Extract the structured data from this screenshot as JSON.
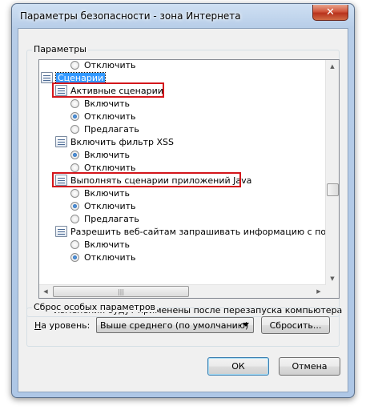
{
  "window": {
    "title": "Параметры безопасности - зона Интернета",
    "close_symbol": "✕"
  },
  "params_group": {
    "label": "Параметры"
  },
  "tree": {
    "rows": [
      {
        "type": "radio",
        "label": "Отключить",
        "checked": false
      },
      {
        "type": "category",
        "label": "Сценарии",
        "icon": "script-icon"
      },
      {
        "type": "setting",
        "label": "Активные сценарии",
        "icon": "script-icon"
      },
      {
        "type": "radio",
        "label": "Включить",
        "checked": false
      },
      {
        "type": "radio",
        "label": "Отключить",
        "checked": true
      },
      {
        "type": "radio",
        "label": "Предлагать",
        "checked": false
      },
      {
        "type": "setting",
        "label": "Включить фильтр XSS",
        "icon": "script-icon"
      },
      {
        "type": "radio",
        "label": "Включить",
        "checked": true
      },
      {
        "type": "radio",
        "label": "Отключить",
        "checked": false
      },
      {
        "type": "setting",
        "label": "Выполнять сценарии приложений Java",
        "icon": "script-icon"
      },
      {
        "type": "radio",
        "label": "Включить",
        "checked": false
      },
      {
        "type": "radio",
        "label": "Отключить",
        "checked": true
      },
      {
        "type": "radio",
        "label": "Предлагать",
        "checked": false
      },
      {
        "type": "setting",
        "label": "Разрешить веб-сайтам запрашивать информацию с помо",
        "icon": "script-icon"
      },
      {
        "type": "radio",
        "label": "Включить",
        "checked": false
      },
      {
        "type": "radio",
        "label": "Отключить",
        "checked": true
      }
    ],
    "hthumb_grip": "|||"
  },
  "note": "* Изменения будут применены после перезапуска компьютера",
  "reset_group": {
    "label": "Сброс особых параметров",
    "level_label_underlined": "Н",
    "level_label_rest": "а уровень:",
    "level_value": "Выше среднего (по умолчанию)",
    "reset_button": "Сбросить..."
  },
  "buttons": {
    "ok": "ОК",
    "cancel": "Отмена"
  },
  "colors": {
    "highlight": "#3399ff",
    "callout": "#d4161b"
  }
}
